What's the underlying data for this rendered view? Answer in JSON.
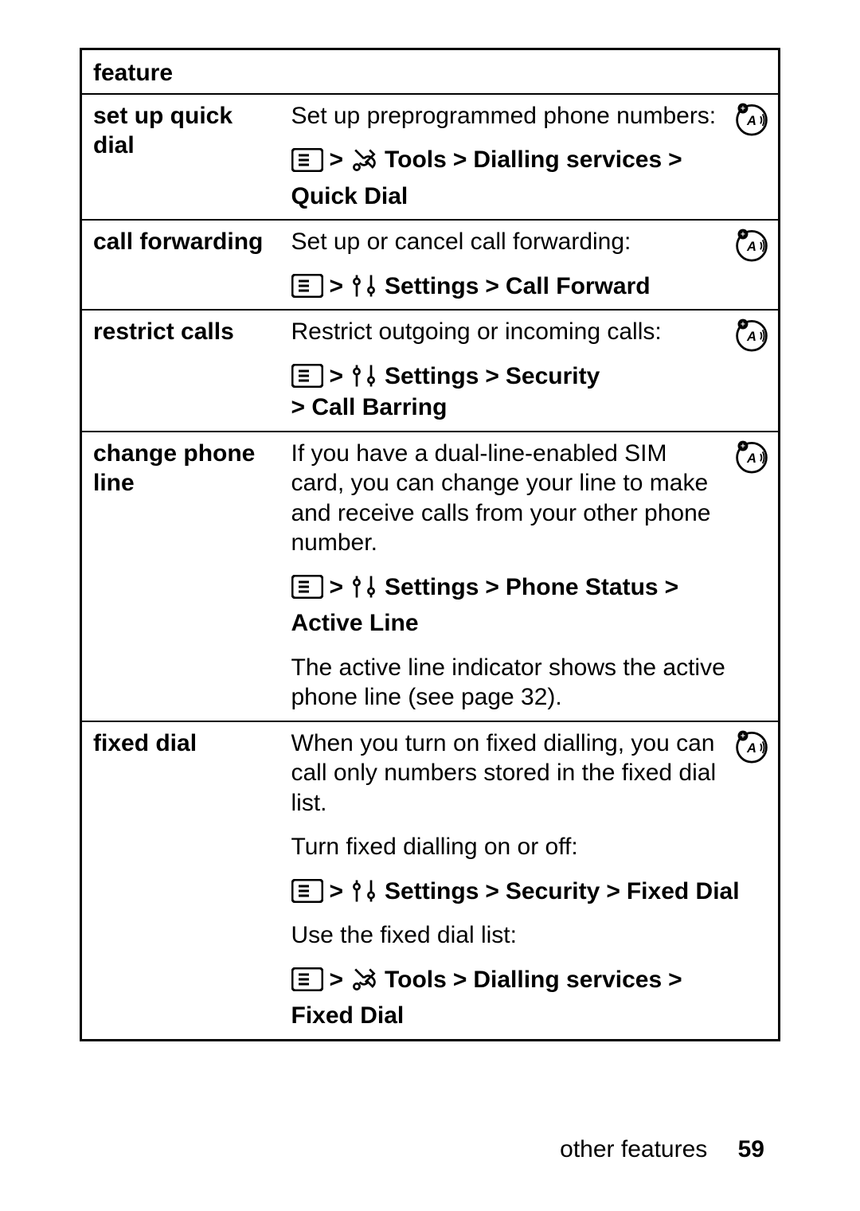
{
  "header": "feature",
  "rows": [
    {
      "feature": "set up quick dial",
      "desc1": "Set up preprogrammed phone numbers:",
      "nav1": [
        "Tools",
        "Dialling services",
        "Quick Dial"
      ],
      "nav1_icon2": "tools"
    },
    {
      "feature": "call forwarding",
      "desc1": "Set up or cancel call forwarding:",
      "nav1": [
        "Settings",
        "Call Forward"
      ],
      "nav1_icon2": "settings"
    },
    {
      "feature": "restrict calls",
      "desc1": "Restrict outgoing or incoming calls:",
      "nav1": [
        "Settings",
        "Security"
      ],
      "nav1_cont": "> Call Barring",
      "nav1_icon2": "settings"
    },
    {
      "feature": "change phone line",
      "desc1": "If you have a dual-line-enabled SIM card, you can change your line to make and receive calls from your other phone number.",
      "nav1": [
        "Settings",
        "Phone Status",
        "Active Line"
      ],
      "nav1_icon2": "settings",
      "desc2": "The active line indicator shows the active phone line (see page 32)."
    },
    {
      "feature": "fixed dial",
      "desc1": "When you turn on fixed dialling, you can call only numbers stored in the fixed dial list.",
      "plain1": "Turn fixed dialling on or off:",
      "nav1": [
        "Settings",
        "Security",
        "Fixed Dial"
      ],
      "nav1_icon2": "settings",
      "plain2": "Use the fixed dial list:",
      "nav2": [
        "Tools",
        "Dialling services",
        "Fixed Dial"
      ],
      "nav2_icon2": "tools"
    }
  ],
  "footer_label": "other features",
  "page_number": "59",
  "gt": ">"
}
